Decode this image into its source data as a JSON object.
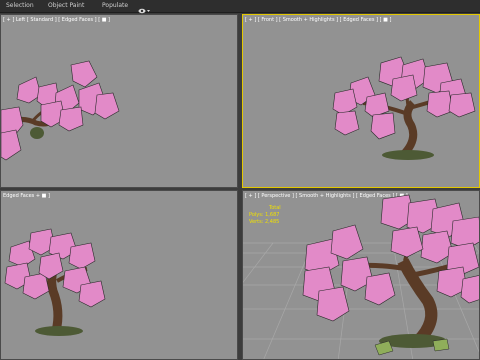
{
  "menu": {
    "items": [
      "Selection",
      "Object Paint",
      "Populate"
    ],
    "extra_icon": "viewport-options-icon"
  },
  "viewports": {
    "top_left": {
      "label": "[ + ] Left [ Standard ] [ Edged Faces ] [ ■ ]"
    },
    "top_right": {
      "label": "[ + ] [ Front ] [ Smooth + Highlights ] [ Edged Faces ] [ ■ ]"
    },
    "bottom_left": {
      "label": "Edged Faces + ■ ]"
    },
    "bottom_right": {
      "label": "[ + ] [ Perspective ] [ Smooth + Highlights ] [ Edged Faces ] [ ■ ]",
      "stats": {
        "title": "Total",
        "polys": "Polys: 1,687",
        "verts": "Verts: 2,485"
      }
    }
  },
  "colors": {
    "viewport_bg": "#929292",
    "blossom": "#e28ac8",
    "trunk": "#5a3b26",
    "active_border": "#e3c800"
  }
}
